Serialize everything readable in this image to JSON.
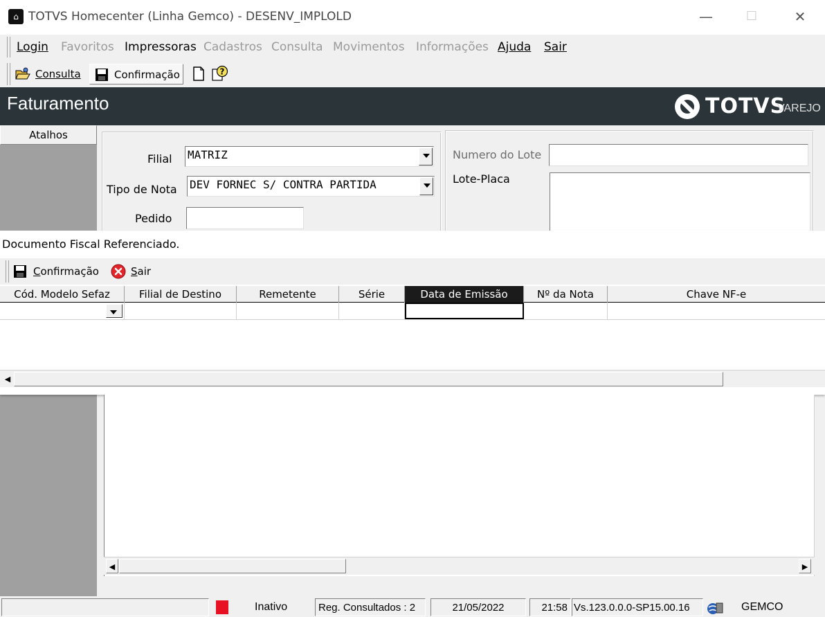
{
  "window": {
    "title": "TOTVS Homecenter (Linha Gemco) - DESENV_IMPLOLD",
    "minimize": "—",
    "maximize": "☐",
    "close": "✕"
  },
  "menu": {
    "items": [
      {
        "label": "Login",
        "enabled": true
      },
      {
        "label": "Favoritos",
        "enabled": false
      },
      {
        "label": "Impressoras",
        "enabled": true
      },
      {
        "label": "Cadastros",
        "enabled": false
      },
      {
        "label": "Consulta",
        "enabled": false
      },
      {
        "label": "Movimentos",
        "enabled": false
      },
      {
        "label": "Informações",
        "enabled": false
      },
      {
        "label": "Ajuda",
        "enabled": true
      },
      {
        "label": "Sair",
        "enabled": true
      }
    ]
  },
  "toolbar": {
    "consulta": "Consulta",
    "confirmacao": "Confirmação"
  },
  "header": {
    "title": "Faturamento",
    "logo": "TOTVS",
    "logo_sub": "VAREJO"
  },
  "sidebar": {
    "atalhos": "Atalhos"
  },
  "form": {
    "filial_label": "Filial",
    "filial_value": "MATRIZ",
    "tipo_nota_label": "Tipo de Nota",
    "tipo_nota_value": "DEV FORNEC S/ CONTRA PARTIDA",
    "pedido_label": "Pedido",
    "pedido_value": "",
    "numero_lote_label": "Numero do Lote",
    "numero_lote_value": "",
    "lote_placa_label": "Lote-Placa",
    "lote_placa_value": ""
  },
  "dialog": {
    "title": "Documento Fiscal Referenciado.",
    "confirmacao": "Confirmação",
    "sair": "Sair",
    "columns": [
      "Cód. Modelo Sefaz",
      "Filial de Destino",
      "Remetente",
      "Série",
      "Data de Emissão",
      "Nº da Nota",
      "Chave NF-e"
    ],
    "active_column": "Data de Emissão"
  },
  "status": {
    "indicator_color": "#e81123",
    "estado": "Inativo",
    "reg_consultados": "Reg. Consultados : 2",
    "date": "21/05/2022",
    "time": "21:58",
    "version": "Vs.123.0.0.0-SP15.00.16",
    "system": "GEMCO"
  },
  "colors": {
    "header_bg": "#2b3539",
    "sidebar_bg": "#a0a0a0"
  }
}
